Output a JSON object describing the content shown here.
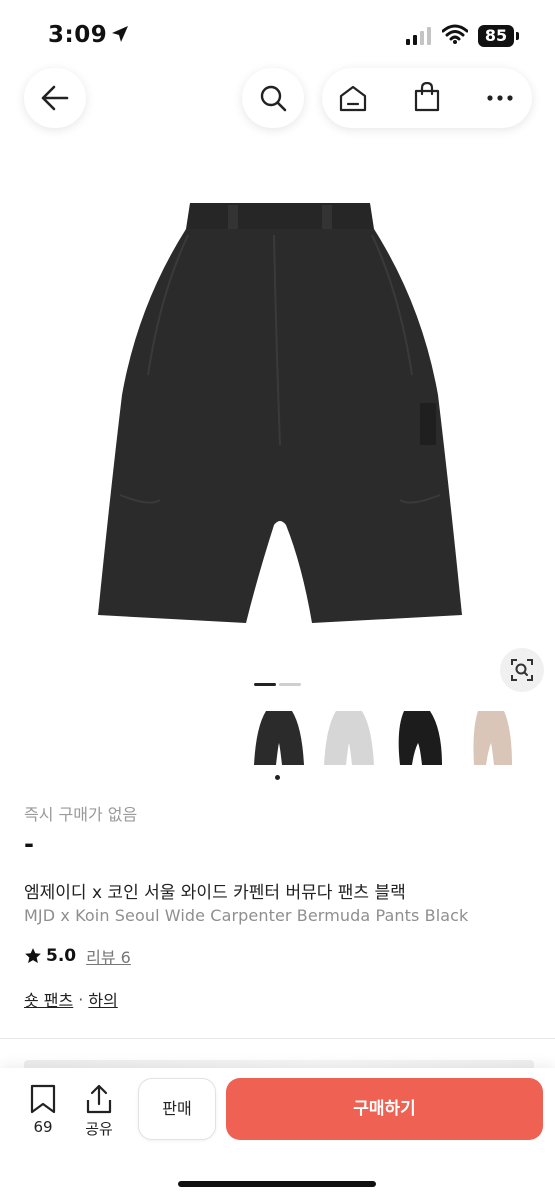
{
  "status_bar": {
    "time": "3:09",
    "battery": "85",
    "icons": [
      "location-arrow-icon",
      "cellular-signal-icon",
      "wifi-icon",
      "battery-icon"
    ]
  },
  "nav": {
    "icons": [
      "back-arrow-icon",
      "search-icon",
      "home-icon",
      "shopping-bag-icon",
      "more-dots-icon"
    ]
  },
  "gallery": {
    "current_image": 1,
    "total_images": 2,
    "thumbnail_count": 4,
    "selected_thumbnail": 1,
    "lens_icon": "image-search-icon"
  },
  "product": {
    "status": "즉시 구매가 없음",
    "price": "-",
    "name_ko": "엠제이디 x 코인 서울 와이드 카펜터 버뮤다 팬츠 블랙",
    "name_en": "MJD x Koin Seoul Wide Carpenter Bermuda Pants Black",
    "rating": "5.0",
    "review_label": "리뷰 6",
    "categories": [
      "숏 팬츠",
      "하의"
    ],
    "category_separator": "·"
  },
  "bottom_bar": {
    "bookmark_count": "69",
    "share_label": "공유",
    "sell_label": "판매",
    "buy_label": "구매하기"
  },
  "colors": {
    "buy_button": "#ef6253",
    "text_primary": "#222222",
    "text_secondary": "#8f8f8f",
    "product_black": "#2a2a2a",
    "thumb_grey": "#d6d6d6",
    "thumb_beige": "#d9c6b8"
  }
}
